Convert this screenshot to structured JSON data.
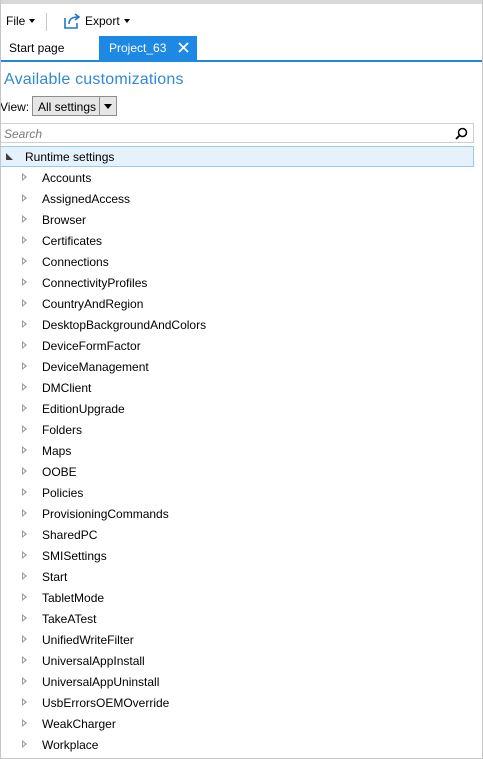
{
  "menu": {
    "file_label": "File",
    "export_label": "Export"
  },
  "tabs": {
    "start_label": "Start page",
    "project_label": "Project_63"
  },
  "panel": {
    "title": "Available customizations",
    "view_label": "View:",
    "view_value": "All settings",
    "search_placeholder": "Search"
  },
  "tree": {
    "root_label": "Runtime settings",
    "items": [
      "Accounts",
      "AssignedAccess",
      "Browser",
      "Certificates",
      "Connections",
      "ConnectivityProfiles",
      "CountryAndRegion",
      "DesktopBackgroundAndColors",
      "DeviceFormFactor",
      "DeviceManagement",
      "DMClient",
      "EditionUpgrade",
      "Folders",
      "Maps",
      "OOBE",
      "Policies",
      "ProvisioningCommands",
      "SharedPC",
      "SMISettings",
      "Start",
      "TabletMode",
      "TakeATest",
      "UnifiedWriteFilter",
      "UniversalAppInstall",
      "UniversalAppUninstall",
      "UsbErrorsOEMOverride",
      "WeakCharger",
      "Workplace"
    ]
  },
  "colors": {
    "accent": "#1e88e5",
    "title": "#2f8ad6",
    "root_highlight": "#e5f1fb"
  }
}
